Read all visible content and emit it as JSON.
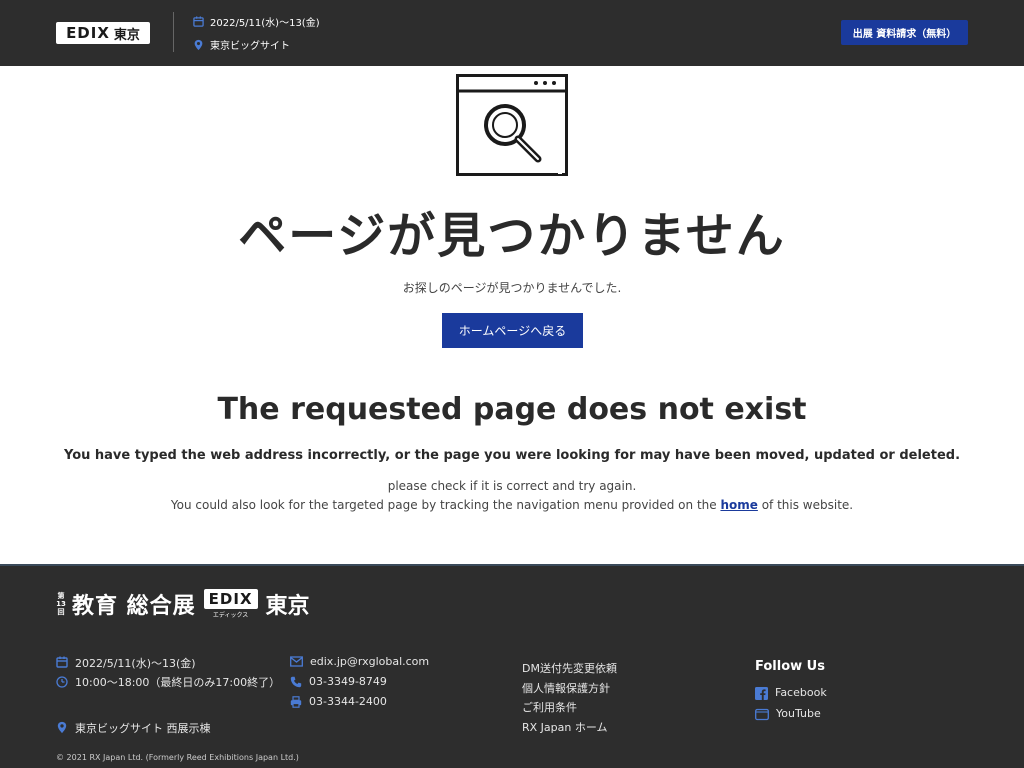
{
  "header": {
    "logo": "EDIX",
    "logo_city": "東京",
    "date": "2022/5/11(水)～13(金)",
    "venue": "東京ビッグサイト",
    "request_button": "出展 資料請求（無料）"
  },
  "main": {
    "icon": "browser-search-icon",
    "jp_title": "ページが見つかりません",
    "jp_subtitle": "お探しのページが見つかりませんでした.",
    "home_button": "ホームページへ戻る",
    "en_title": "The requested page does not exist",
    "en_description": "You have typed the web address incorrectly, or the page you were looking for may have been moved, updated or deleted.",
    "en_check": "please check if it is correct and try again.",
    "en_nav_before": "You could also look for the targeted page by tracking the navigation menu provided on the ",
    "en_nav_link": "home",
    "en_nav_after": " of this website."
  },
  "footer": {
    "logo_round": "第13回",
    "logo_title": "教育 総合展",
    "logo_edix": "EDIX",
    "logo_edix_kana": "エディックス",
    "logo_city": "東京",
    "date": "2022/5/11(水)～13(金)",
    "hours": "10:00～18:00（最終日のみ17:00終了）",
    "venue": "東京ビッグサイト 西展示棟",
    "email": "edix.jp@rxglobal.com",
    "phone": "03-3349-8749",
    "fax": "03-3344-2400",
    "links": [
      "DM送付先変更依頼",
      "個人情報保護方針",
      "ご利用条件",
      "RX Japan ホーム"
    ],
    "follow_title": "Follow Us",
    "social": [
      "Facebook",
      "YouTube"
    ],
    "copyright": "© 2021 RX Japan Ltd. (Formerly Reed Exhibitions Japan Ltd.)"
  },
  "colors": {
    "header_bg": "#2d2d2d",
    "accent_blue": "#1a3a9c",
    "footer_bg": "#2d2d2d"
  }
}
